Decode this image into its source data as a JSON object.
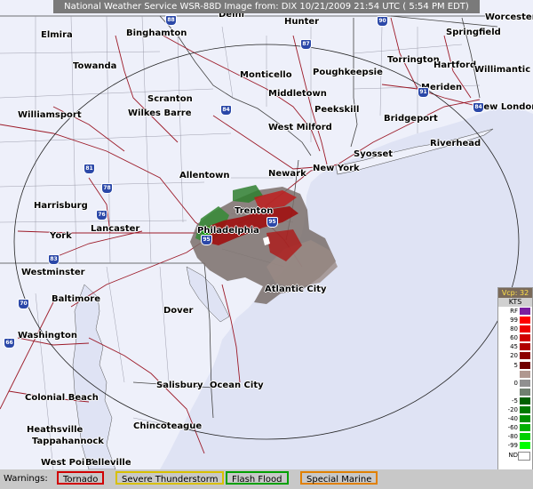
{
  "title": "National Weather Service WSR-88D Image  from: DIX 10/21/2009 21:54 UTC ( 5:54 PM EDT)",
  "cities": [
    {
      "name": "Elmira"
    },
    {
      "name": "Binghamton"
    },
    {
      "name": "Delhi"
    },
    {
      "name": "Hunter"
    },
    {
      "name": "Worcester"
    },
    {
      "name": "Springfield"
    },
    {
      "name": "Towanda"
    },
    {
      "name": "Monticello"
    },
    {
      "name": "Poughkeepsie"
    },
    {
      "name": "Torrington"
    },
    {
      "name": "Hartford"
    },
    {
      "name": "Willimantic"
    },
    {
      "name": "Meriden"
    },
    {
      "name": "New London"
    },
    {
      "name": "Middletown"
    },
    {
      "name": "Peekskill"
    },
    {
      "name": "Bridgeport"
    },
    {
      "name": "Scranton"
    },
    {
      "name": "Wilkes Barre"
    },
    {
      "name": "Williamsport"
    },
    {
      "name": "West Milford"
    },
    {
      "name": "Riverhead"
    },
    {
      "name": "Syosset"
    },
    {
      "name": "New York"
    },
    {
      "name": "Newark"
    },
    {
      "name": "Allentown"
    },
    {
      "name": "Trenton"
    },
    {
      "name": "Harrisburg"
    },
    {
      "name": "Lancaster"
    },
    {
      "name": "Philadelphia"
    },
    {
      "name": "York"
    },
    {
      "name": "Westminster"
    },
    {
      "name": "Atlantic City"
    },
    {
      "name": "Baltimore"
    },
    {
      "name": "Washington"
    },
    {
      "name": "Dover"
    },
    {
      "name": "Salisbury"
    },
    {
      "name": "Ocean City"
    },
    {
      "name": "Colonial Beach"
    },
    {
      "name": "Chincoteague"
    },
    {
      "name": "Heathsville"
    },
    {
      "name": "Tappahannock"
    },
    {
      "name": "West Point"
    },
    {
      "name": "Belleville"
    }
  ],
  "shields": [
    "88",
    "87",
    "90",
    "84",
    "91",
    "84",
    "81",
    "78",
    "76",
    "83",
    "70",
    "95",
    "95",
    "66"
  ],
  "legend": {
    "header": "Vcp: 32",
    "unit": "KTS",
    "rows": [
      {
        "label": "RF",
        "color": "#7a1fa0"
      },
      {
        "label": "99",
        "color": "#ff0000"
      },
      {
        "label": "80",
        "color": "#ee0000"
      },
      {
        "label": "60",
        "color": "#d00000"
      },
      {
        "label": "45",
        "color": "#b00000"
      },
      {
        "label": "20",
        "color": "#8c0000"
      },
      {
        "label": "5",
        "color": "#700000"
      },
      {
        "label": "",
        "color": "#b09890"
      },
      {
        "label": "0",
        "color": "#909090"
      },
      {
        "label": "",
        "color": "#708070"
      },
      {
        "label": "-5",
        "color": "#006000"
      },
      {
        "label": "-20",
        "color": "#007a00"
      },
      {
        "label": "-40",
        "color": "#009000"
      },
      {
        "label": "-60",
        "color": "#00b000"
      },
      {
        "label": "-80",
        "color": "#00d000"
      },
      {
        "label": "-99",
        "color": "#00ff00"
      },
      {
        "label": "ND",
        "color": "#ffffff"
      }
    ]
  },
  "warnings": {
    "label": "Warnings:",
    "items": [
      {
        "name": "Tornado",
        "color": "#d00000"
      },
      {
        "name": "Severe Thunderstorm",
        "color": "#d8c000"
      },
      {
        "name": "Flash Flood",
        "color": "#00a000"
      },
      {
        "name": "Special Marine",
        "color": "#e08000"
      }
    ]
  }
}
